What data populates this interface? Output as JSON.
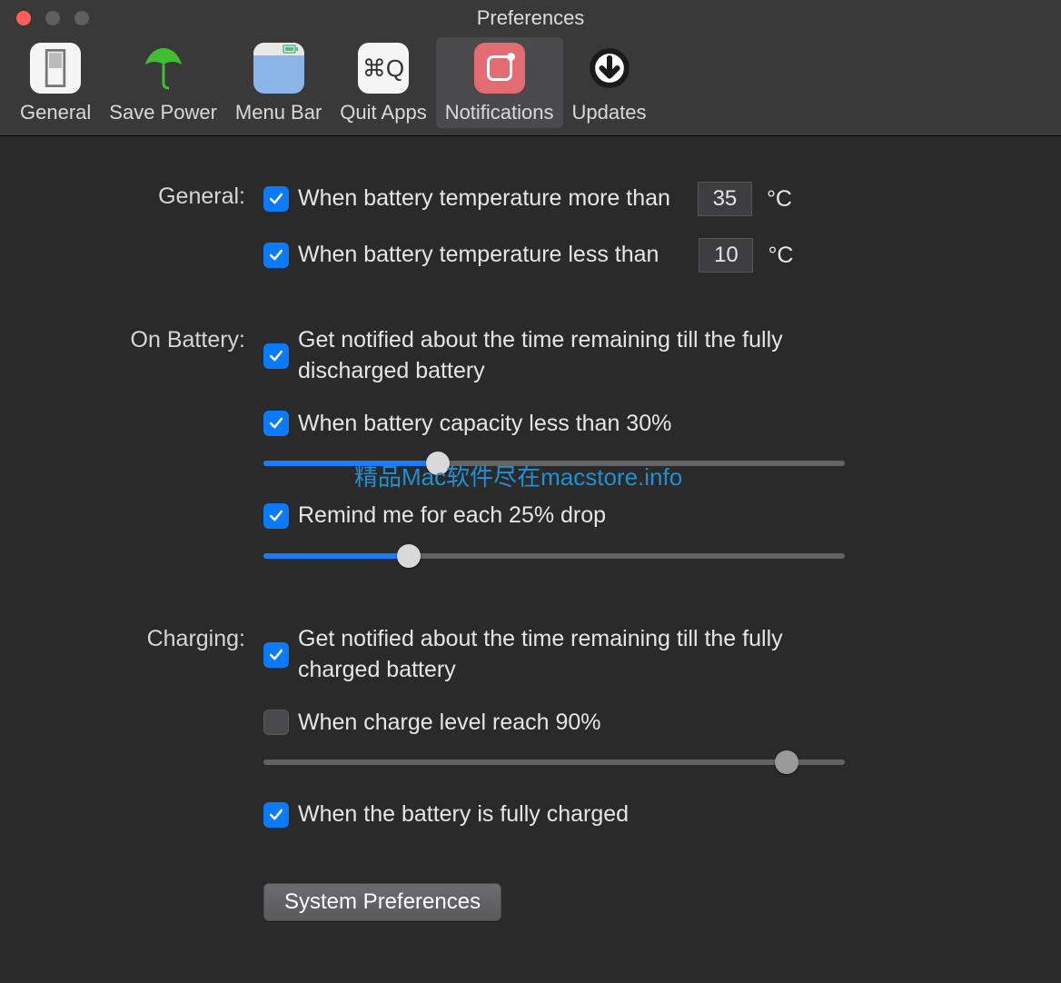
{
  "window": {
    "title": "Preferences"
  },
  "traffic": {
    "close": "#ff5f57",
    "min": "#5f5f5f",
    "zoom": "#5f5f5f"
  },
  "toolbar": {
    "items": [
      {
        "label": "General"
      },
      {
        "label": "Save Power"
      },
      {
        "label": "Menu Bar"
      },
      {
        "label": "Quit Apps"
      },
      {
        "label": "Notifications"
      },
      {
        "label": "Updates"
      }
    ],
    "active_index": 4
  },
  "sections": {
    "general": {
      "label": "General:"
    },
    "onbattery": {
      "label": "On Battery:"
    },
    "charging": {
      "label": "Charging:"
    }
  },
  "general_opts": {
    "temp_more": {
      "label": "When battery temperature more than",
      "value": "35",
      "unit": "°C",
      "checked": true
    },
    "temp_less": {
      "label": "When battery temperature less than",
      "value": "10",
      "unit": "°C",
      "checked": true
    }
  },
  "onbattery_opts": {
    "time_remaining": {
      "label": "Get notified about the time remaining till the fully discharged battery",
      "checked": true
    },
    "capacity": {
      "label": "When battery capacity less than 30%",
      "checked": true,
      "slider_percent": 30
    },
    "remind": {
      "label": "Remind me for each 25% drop",
      "checked": true,
      "slider_percent": 25
    }
  },
  "charging_opts": {
    "time_remaining": {
      "label": "Get notified about the time remaining till the fully charged battery",
      "checked": true
    },
    "charge_level": {
      "label": "When charge level reach 90%",
      "checked": false,
      "slider_percent": 90
    },
    "fully_charged": {
      "label": "When the battery is fully charged",
      "checked": true
    }
  },
  "button": {
    "system_prefs": "System Preferences"
  },
  "watermark": "精品Mac软件尽在macstore.info"
}
